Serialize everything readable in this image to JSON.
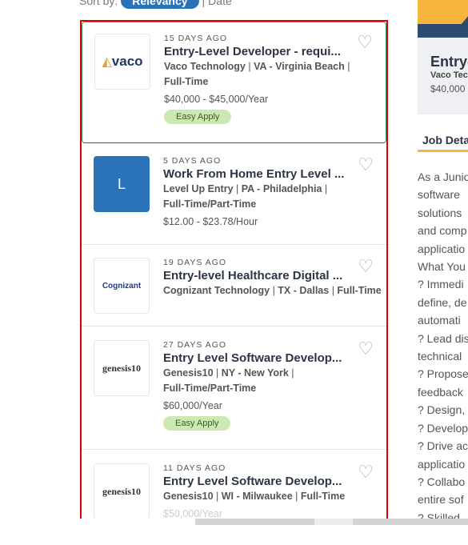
{
  "sort": {
    "label": "Sort by:",
    "relevancy": "Relevancy",
    "sep": "|",
    "date": "Date"
  },
  "jobs": [
    {
      "ago": "15 DAYS AGO",
      "title": "Entry-Level Developer - requi...",
      "company": "Vaco Technology",
      "location": "VA - Virginia Beach",
      "type": "Full-Time",
      "salary": "$40,000 - $45,000/Year",
      "easy_apply": "Easy Apply",
      "logo": "vaco"
    },
    {
      "ago": "5 DAYS AGO",
      "title": "Work From Home Entry Level ...",
      "company": "Level Up Entry",
      "location": "PA - Philadelphia",
      "type": "Full-Time/Part-Time",
      "salary": "$12.00 - $23.78/Hour",
      "logo": "L"
    },
    {
      "ago": "19 DAYS AGO",
      "title": "Entry-level Healthcare Digital ...",
      "company": "Cognizant Technology",
      "location": "TX - Dallas",
      "type": "Full-Time",
      "logo": "Cognizant"
    },
    {
      "ago": "27 DAYS AGO",
      "title": "Entry Level Software Develop...",
      "company": "Genesis10",
      "location": "NY - New York",
      "type": "Full-Time/Part-Time",
      "salary": "$60,000/Year",
      "easy_apply": "Easy Apply",
      "logo": "genesis10"
    },
    {
      "ago": "11 DAYS AGO",
      "title": "Entry Level Software Develop...",
      "company": "Genesis10",
      "location": "WI - Milwaukee",
      "type": "Full-Time",
      "salary": "$50,000/Year",
      "logo": "genesis10"
    }
  ],
  "detail": {
    "title": "Entry-Level Developer",
    "company": "Vaco Technology",
    "salary": "$40,000",
    "section": "Job Details",
    "lines": [
      "As a Junior",
      "software",
      "solutions",
      "and comp",
      "applicatio",
      "What You",
      "? Immedi",
      "define, de",
      "automati",
      "? Lead dis",
      "technical",
      "? Propose",
      "feedback",
      "? Design,",
      "? Develop",
      "? Drive ac",
      "applicatio",
      "? Collabo",
      "entire sof",
      "? Skilled"
    ]
  }
}
